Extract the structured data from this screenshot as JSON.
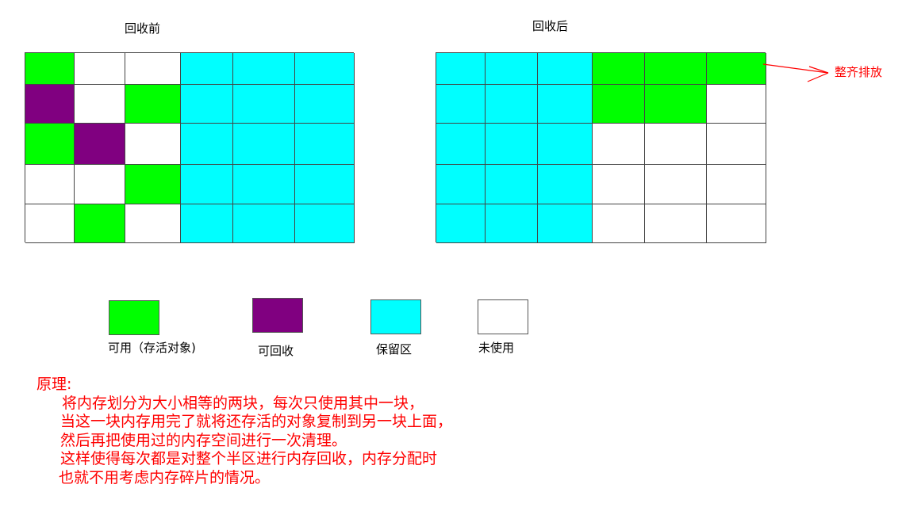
{
  "colors": {
    "alive": "#00ff00",
    "recyclable": "#800080",
    "reserved": "#00ffff",
    "unused": "#ffffff",
    "grid_line": "#444444",
    "annotation": "#ff0000"
  },
  "before": {
    "title": "回收前",
    "cells": [
      [
        "alive",
        "unused",
        "unused",
        "reserved",
        "reserved",
        "reserved"
      ],
      [
        "recyclable",
        "unused",
        "alive",
        "reserved",
        "reserved",
        "reserved"
      ],
      [
        "alive",
        "recyclable",
        "unused",
        "reserved",
        "reserved",
        "reserved"
      ],
      [
        "unused",
        "unused",
        "alive",
        "reserved",
        "reserved",
        "reserved"
      ],
      [
        "unused",
        "alive",
        "unused",
        "reserved",
        "reserved",
        "reserved"
      ]
    ]
  },
  "after": {
    "title": "回收后",
    "cells": [
      [
        "reserved",
        "reserved",
        "reserved",
        "alive",
        "alive",
        "alive"
      ],
      [
        "reserved",
        "reserved",
        "reserved",
        "alive",
        "alive",
        "unused"
      ],
      [
        "reserved",
        "reserved",
        "reserved",
        "unused",
        "unused",
        "unused"
      ],
      [
        "reserved",
        "reserved",
        "reserved",
        "unused",
        "unused",
        "unused"
      ],
      [
        "reserved",
        "reserved",
        "reserved",
        "unused",
        "unused",
        "unused"
      ]
    ]
  },
  "annotation": {
    "label": "整齐排放"
  },
  "legend": [
    {
      "key": "alive",
      "label": "可用（存活对象)"
    },
    {
      "key": "recyclable",
      "label": "可回收"
    },
    {
      "key": "reserved",
      "label": "保留区"
    },
    {
      "key": "unused",
      "label": "未使用"
    }
  ],
  "principle": {
    "heading": "原理:",
    "lines": [
      "将内存划分为大小相等的两块，每次只使用其中一块，",
      "当这一块内存用完了就将还存活的对象复制到另一块上面，",
      "然后再把使用过的内存空间进行一次清理。",
      "这样使得每次都是对整个半区进行内存回收，内存分配时",
      "也就不用考虑内存碎片的情况。"
    ]
  }
}
